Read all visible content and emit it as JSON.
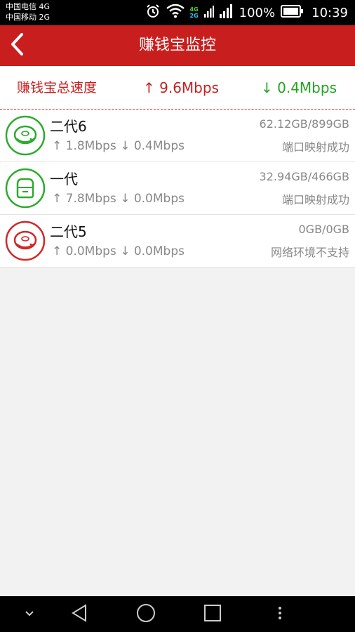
{
  "status_bar": {
    "carrier_1": "中国电信 4G",
    "carrier_2": "中国移动 2G",
    "network_1": "4G",
    "network_2": "2G",
    "battery": "100%",
    "time": "10:39"
  },
  "app_bar": {
    "title": "赚钱宝监控",
    "back_icon": "back-chevron-icon"
  },
  "summary": {
    "label": "赚钱宝总速度",
    "upload": "↑ 9.6Mbps",
    "download": "↓ 0.4Mbps"
  },
  "devices": [
    {
      "name": "二代6",
      "speed": "↑ 1.8Mbps ↓ 0.4Mbps",
      "storage": "62.12GB/899GB",
      "status": "端口映射成功",
      "icon": "round-device-icon",
      "color": "#2eaa2e"
    },
    {
      "name": "一代",
      "speed": "↑ 7.8Mbps ↓ 0.0Mbps",
      "storage": "32.94GB/466GB",
      "status": "端口映射成功",
      "icon": "box-device-icon",
      "color": "#2eaa2e"
    },
    {
      "name": "二代5",
      "speed": "↑ 0.0Mbps ↓ 0.0Mbps",
      "storage": "0GB/0GB",
      "status": "网络环境不支持",
      "icon": "round-device-icon",
      "color": "#d02828"
    }
  ],
  "colors": {
    "accent": "#c81e1e",
    "online": "#2eaa2e",
    "offline": "#d02828"
  }
}
